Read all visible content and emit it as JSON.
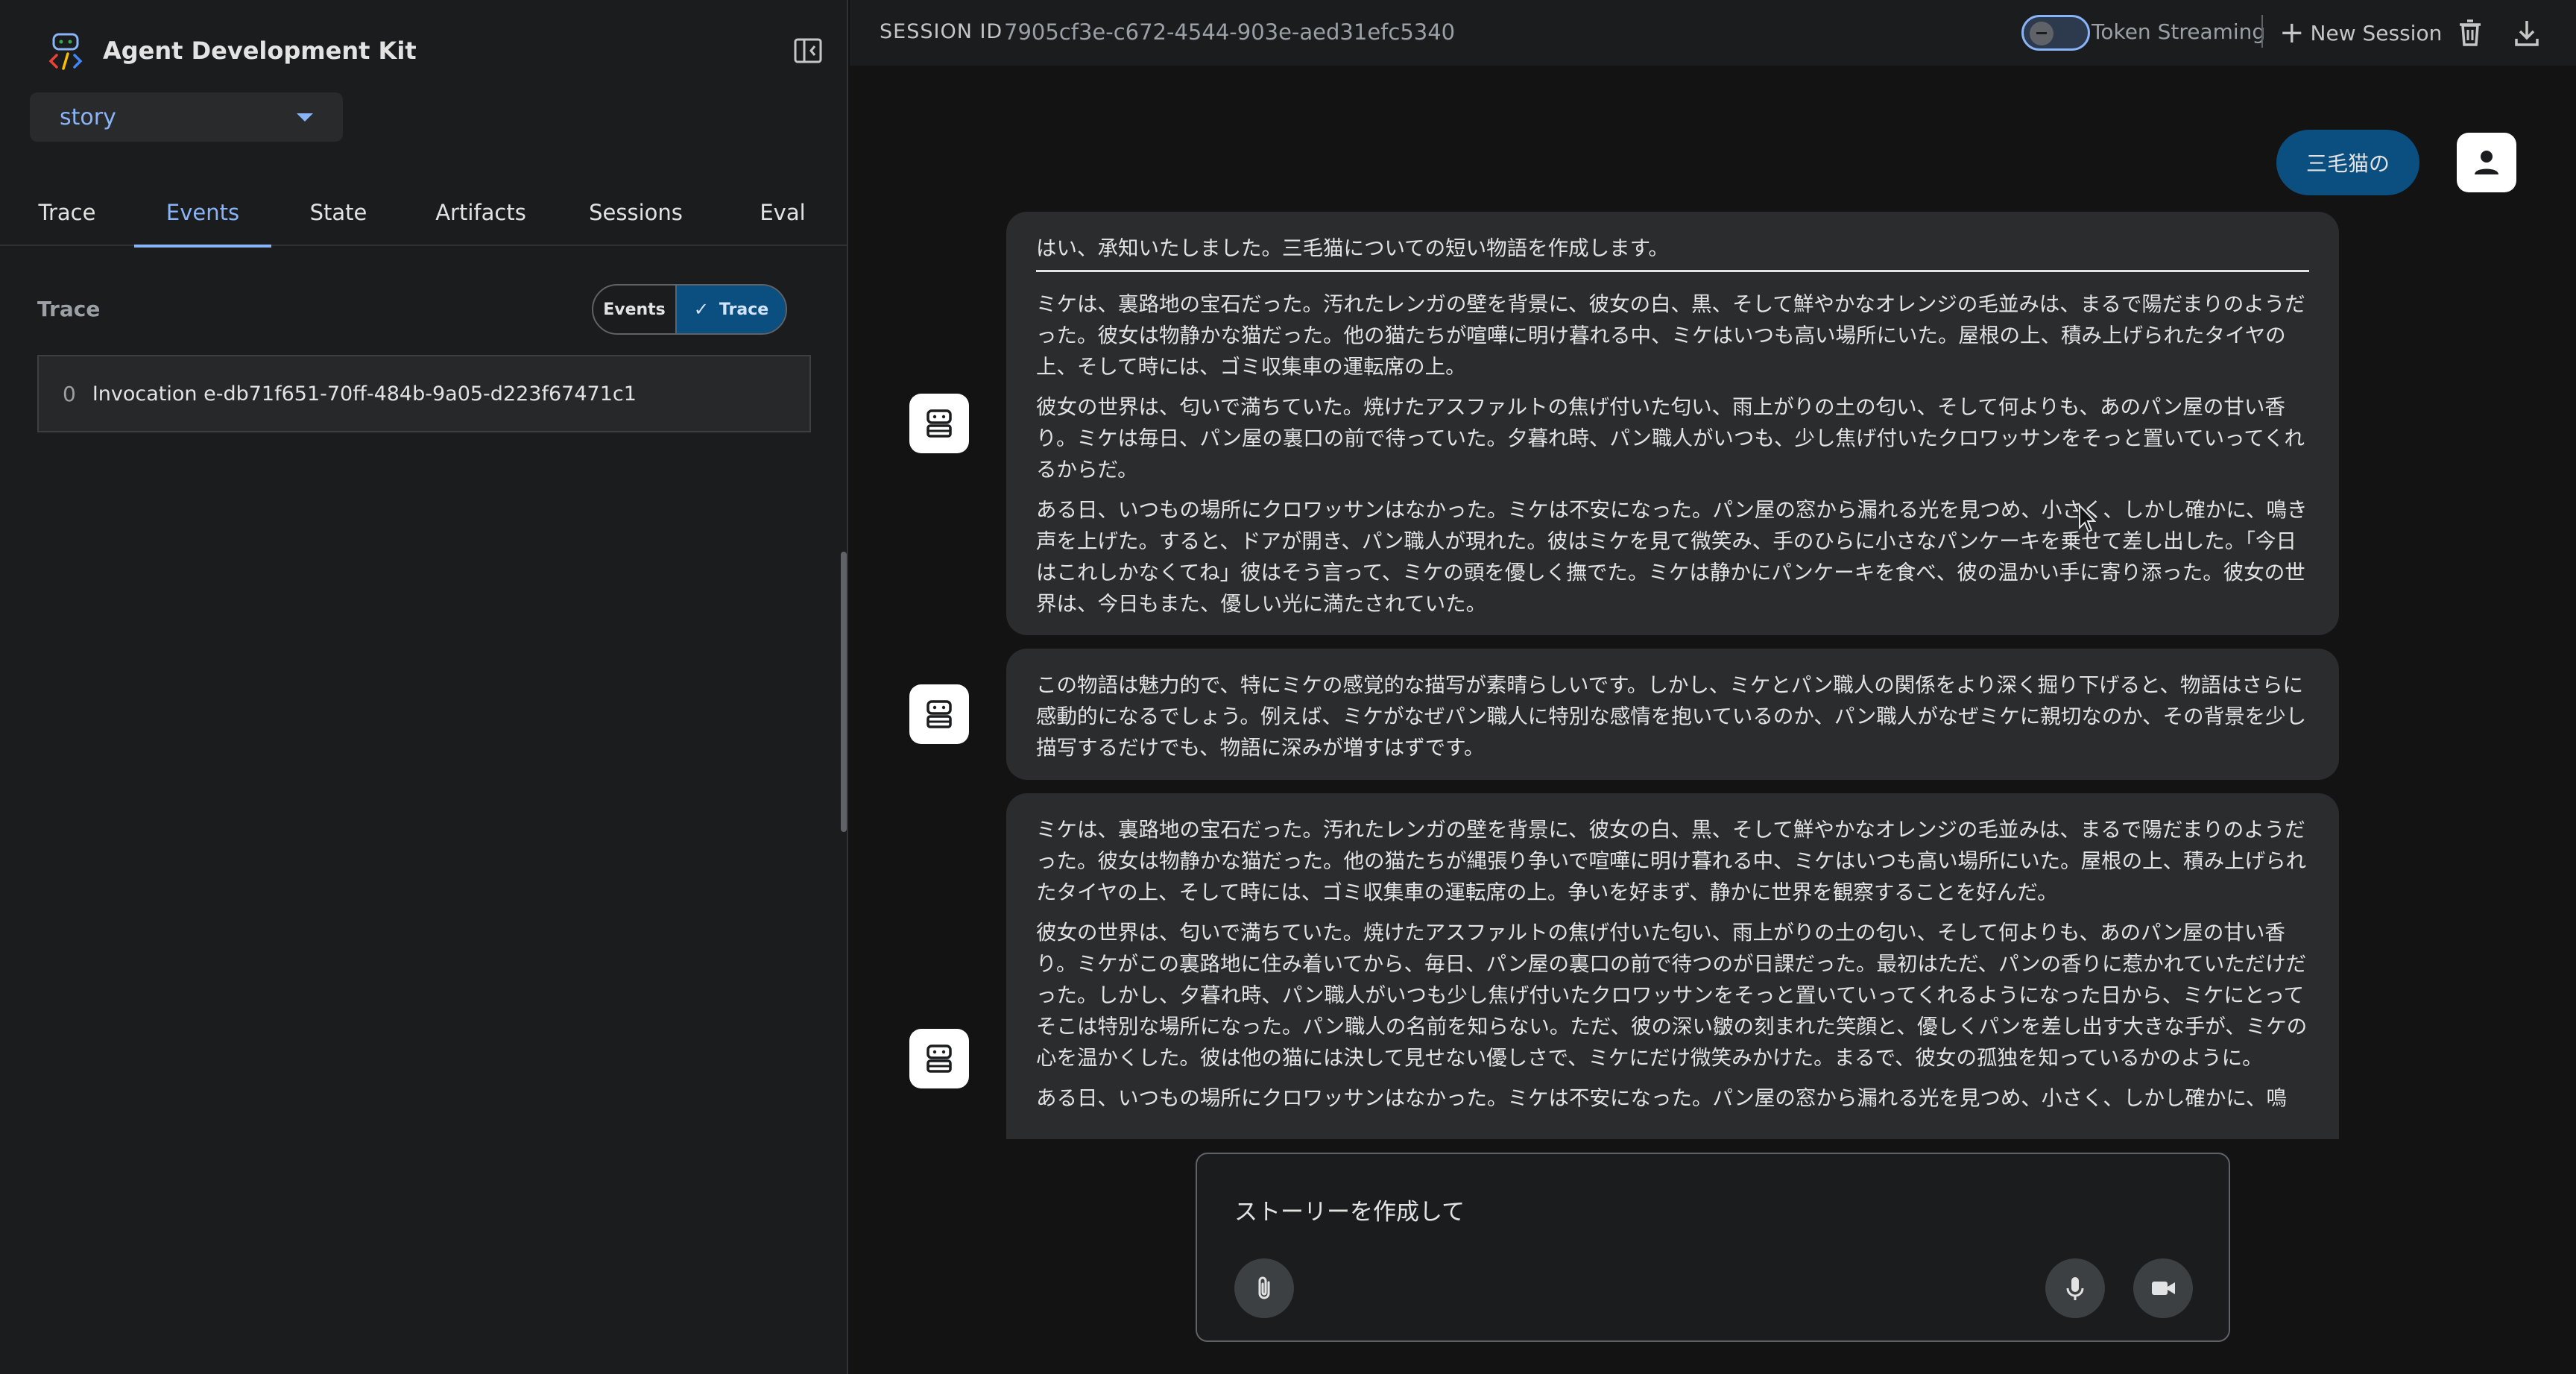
{
  "app": {
    "title": "Agent Development Kit",
    "selected_app": "story"
  },
  "tabs": [
    {
      "label": "Trace"
    },
    {
      "label": "Events"
    },
    {
      "label": "State"
    },
    {
      "label": "Artifacts"
    },
    {
      "label": "Sessions"
    },
    {
      "label": "Eval"
    }
  ],
  "active_tab": "Events",
  "trace_panel": {
    "heading": "Trace",
    "toggle_events": "Events",
    "toggle_trace": "Trace",
    "invocation_index": "0",
    "invocation_label": "Invocation e-db71f651-70ff-484b-9a05-d223f67471c1"
  },
  "topbar": {
    "session_label": "SESSION ID",
    "session_id": "7905cf3e-c672-4544-903e-aed31efc5340",
    "token_streaming": "Token Streaming",
    "new_session": "New Session"
  },
  "chat": {
    "user_message": "三毛猫の",
    "bot1": {
      "lead": "はい、承知いたしました。三毛猫についての短い物語を作成します。",
      "p1": "ミケは、裏路地の宝石だった。汚れたレンガの壁を背景に、彼女の白、黒、そして鮮やかなオレンジの毛並みは、まるで陽だまりのようだった。彼女は物静かな猫だった。他の猫たちが喧嘩に明け暮れる中、ミケはいつも高い場所にいた。屋根の上、積み上げられたタイヤの上、そして時には、ゴミ収集車の運転席の上。",
      "p2": "彼女の世界は、匂いで満ちていた。焼けたアスファルトの焦げ付いた匂い、雨上がりの土の匂い、そして何よりも、あのパン屋の甘い香り。ミケは毎日、パン屋の裏口の前で待っていた。夕暮れ時、パン職人がいつも、少し焦げ付いたクロワッサンをそっと置いていってくれるからだ。",
      "p3": "ある日、いつもの場所にクロワッサンはなかった。ミケは不安になった。パン屋の窓から漏れる光を見つめ、小さく、しかし確かに、鳴き声を上げた。すると、ドアが開き、パン職人が現れた。彼はミケを見て微笑み、手のひらに小さなパンケーキを乗せて差し出した。「今日はこれしかなくてね」彼はそう言って、ミケの頭を優しく撫でた。ミケは静かにパンケーキを食べ、彼の温かい手に寄り添った。彼女の世界は、今日もまた、優しい光に満たされていた。"
    },
    "bot2": {
      "p1": "この物語は魅力的で、特にミケの感覚的な描写が素晴らしいです。しかし、ミケとパン職人の関係をより深く掘り下げると、物語はさらに感動的になるでしょう。例えば、ミケがなぜパン職人に特別な感情を抱いているのか、パン職人がなぜミケに親切なのか、その背景を少し描写するだけでも、物語に深みが増すはずです。"
    },
    "bot3": {
      "p1": "ミケは、裏路地の宝石だった。汚れたレンガの壁を背景に、彼女の白、黒、そして鮮やかなオレンジの毛並みは、まるで陽だまりのようだった。彼女は物静かな猫だった。他の猫たちが縄張り争いで喧嘩に明け暮れる中、ミケはいつも高い場所にいた。屋根の上、積み上げられたタイヤの上、そして時には、ゴミ収集車の運転席の上。争いを好まず、静かに世界を観察することを好んだ。",
      "p2": "彼女の世界は、匂いで満ちていた。焼けたアスファルトの焦げ付いた匂い、雨上がりの土の匂い、そして何よりも、あのパン屋の甘い香り。ミケがこの裏路地に住み着いてから、毎日、パン屋の裏口の前で待つのが日課だった。最初はただ、パンの香りに惹かれていただけだった。しかし、夕暮れ時、パン職人がいつも少し焦げ付いたクロワッサンをそっと置いていってくれるようになった日から、ミケにとってそこは特別な場所になった。パン職人の名前を知らない。ただ、彼の深い皺の刻まれた笑顔と、優しくパンを差し出す大きな手が、ミケの心を温かくした。彼は他の猫には決して見せない優しさで、ミケにだけ微笑みかけた。まるで、彼女の孤独を知っているかのように。",
      "p3": "ある日、いつもの場所にクロワッサンはなかった。ミケは不安になった。パン屋の窓から漏れる光を見つめ、小さく、しかし確かに、鳴"
    }
  },
  "input": {
    "value": "ストーリーを作成して"
  },
  "icons": {
    "collapse": "sidebar-collapse-icon",
    "delete": "delete-icon",
    "download": "download-icon",
    "attach": "attach-icon",
    "mic": "mic-icon",
    "video": "video-icon",
    "user": "person-icon",
    "bot": "robot-icon"
  },
  "colors": {
    "accent": "#8ab4f8",
    "user_bubble": "#0b4f80",
    "bot_bubble": "#2b2c2e",
    "background": "#131314"
  }
}
